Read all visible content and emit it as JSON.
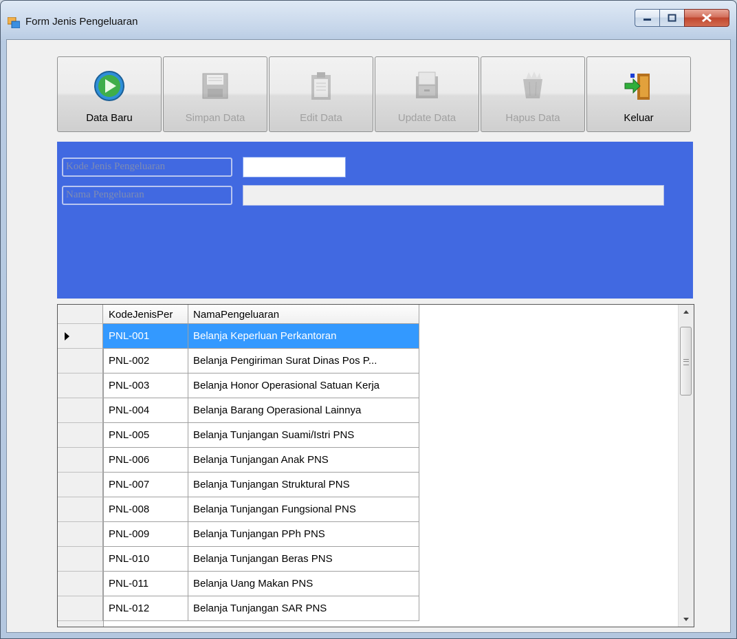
{
  "window": {
    "title": "Form Jenis Pengeluaran",
    "icon": "form-app-icon",
    "controls": [
      "minimize-icon",
      "maximize-icon",
      "close-icon"
    ]
  },
  "toolbar": {
    "buttons": [
      {
        "label": "Data Baru",
        "icon": "play-circle-icon",
        "enabled": true
      },
      {
        "label": "Simpan Data",
        "icon": "floppy-disk-icon",
        "enabled": false
      },
      {
        "label": "Edit Data",
        "icon": "clipboard-icon",
        "enabled": false
      },
      {
        "label": "Update Data",
        "icon": "file-cabinet-icon",
        "enabled": false
      },
      {
        "label": "Hapus Data",
        "icon": "trash-bin-icon",
        "enabled": false
      },
      {
        "label": "Keluar",
        "icon": "exit-door-icon",
        "enabled": true
      }
    ]
  },
  "form": {
    "kode_label": "Kode Jenis Pengeluaran",
    "kode_value": "",
    "nama_label": "Nama Pengeluaran",
    "nama_value": "",
    "panel_color": "#4169e1"
  },
  "grid": {
    "columns": [
      "KodeJenisPer",
      "NamaPengeluaran"
    ],
    "selected_row": 0,
    "rows": [
      {
        "kode": "PNL-001",
        "nama": "Belanja Keperluan Perkantoran"
      },
      {
        "kode": "PNL-002",
        "nama": "Belanja Pengiriman Surat Dinas Pos P..."
      },
      {
        "kode": "PNL-003",
        "nama": "Belanja Honor Operasional Satuan Kerja"
      },
      {
        "kode": "PNL-004",
        "nama": "Belanja Barang Operasional Lainnya"
      },
      {
        "kode": "PNL-005",
        "nama": "Belanja Tunjangan Suami/Istri PNS"
      },
      {
        "kode": "PNL-006",
        "nama": "Belanja Tunjangan Anak PNS"
      },
      {
        "kode": "PNL-007",
        "nama": "Belanja Tunjangan Struktural PNS"
      },
      {
        "kode": "PNL-008",
        "nama": "Belanja Tunjangan Fungsional PNS"
      },
      {
        "kode": "PNL-009",
        "nama": "Belanja Tunjangan PPh PNS"
      },
      {
        "kode": "PNL-010",
        "nama": "Belanja Tunjangan Beras PNS"
      },
      {
        "kode": "PNL-011",
        "nama": "Belanja Uang Makan PNS"
      },
      {
        "kode": "PNL-012",
        "nama": "Belanja Tunjangan SAR PNS"
      }
    ]
  }
}
